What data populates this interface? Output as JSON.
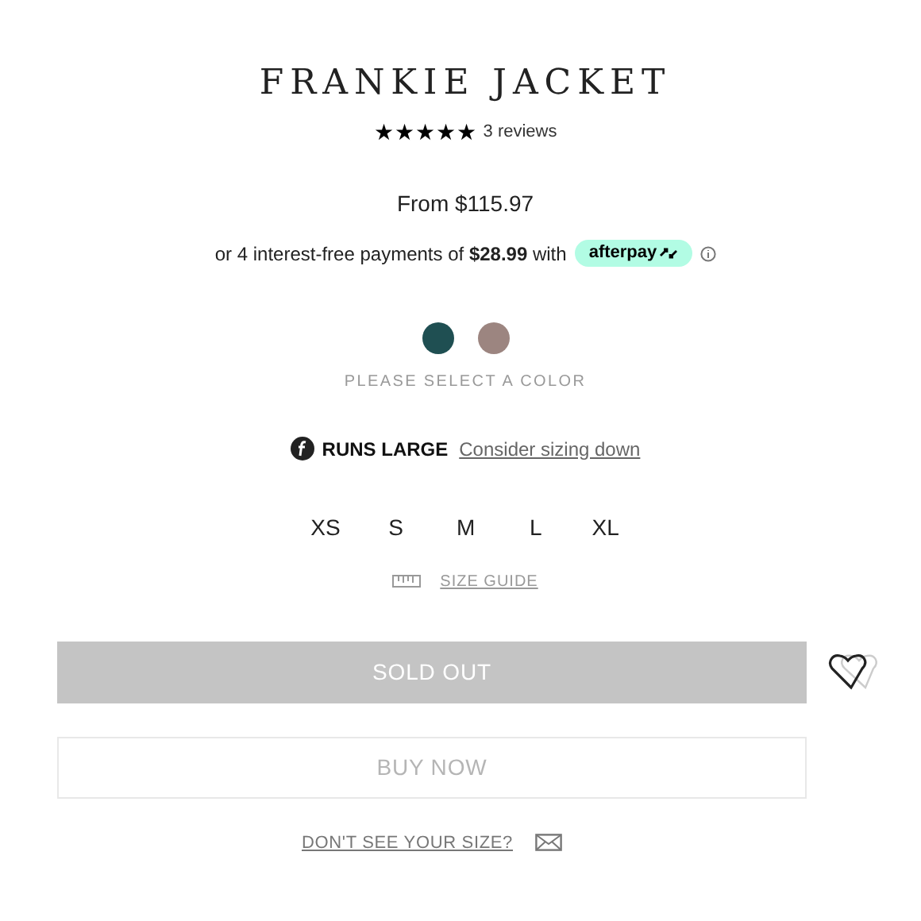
{
  "title": "FRANKIE JACKET",
  "rating": {
    "stars": 5,
    "reviews": "3 reviews"
  },
  "price": "From $115.97",
  "installments": {
    "text": "or 4 interest-free payments of **$28.99** with",
    "provider": "afterpay"
  },
  "colors": [
    {
      "color": "#1f4f52",
      "selected": false
    },
    {
      "color": "#9c8580",
      "selected": false
    }
  ],
  "color_prompt": "PLEASE SELECT A COLOR",
  "fit": {
    "label": "RUNS LARGE",
    "link": "Consider sizing down"
  },
  "sizes": [
    {
      "label": "XS",
      "selected": false
    },
    {
      "label": "S",
      "selected": false
    },
    {
      "label": "M",
      "selected": false
    },
    {
      "label": "L",
      "selected": false
    },
    {
      "label": "XL",
      "selected": false
    }
  ],
  "size_guide": "SIZE GUIDE",
  "sold_out_button": {
    "label": "SOLD OUT",
    "disabled": true
  },
  "buy_now_button": {
    "label": "BUY NOW",
    "disabled": true
  },
  "size_request": "DON'T SEE YOUR SIZE?"
}
